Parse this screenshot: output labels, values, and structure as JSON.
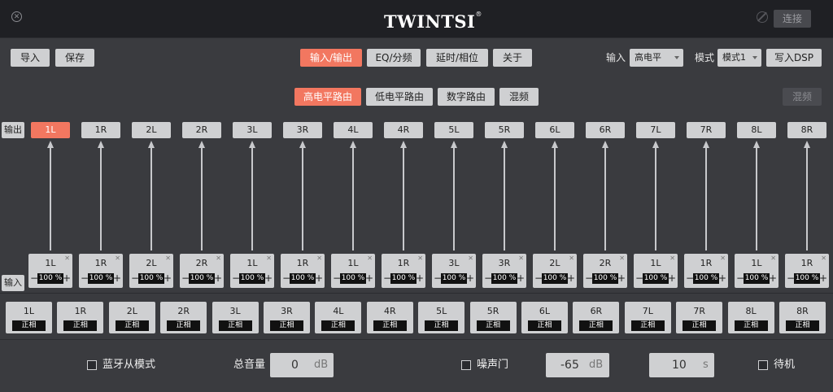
{
  "titlebar": {
    "logo": "TWINTSI",
    "registered": "®",
    "close_glyph": "✕",
    "connect_label": "连接"
  },
  "toolbar": {
    "import_label": "导入",
    "save_label": "保存",
    "tabs": [
      "输入/输出",
      "EQ/分频",
      "延时/相位",
      "关于"
    ],
    "active_tab": 0,
    "input_label": "输入",
    "input_value": "高电平",
    "mode_label": "模式",
    "mode_value": "模式1",
    "write_dsp_label": "写入DSP"
  },
  "routing": {
    "tabs": [
      "高电平路由",
      "低电平路由",
      "数字路由",
      "混频"
    ],
    "active_tab": 0,
    "mix_button_label": "混频"
  },
  "matrix": {
    "output_label": "输出",
    "input_label": "输入",
    "outputs": [
      "1L",
      "1R",
      "2L",
      "2R",
      "3L",
      "3R",
      "4L",
      "4R",
      "5L",
      "5R",
      "6L",
      "6R",
      "7L",
      "7R",
      "8L",
      "8R"
    ],
    "active_output": 0,
    "mix_inputs": [
      {
        "ch": "1L",
        "value": "100 %"
      },
      {
        "ch": "1R",
        "value": "100 %"
      },
      {
        "ch": "2L",
        "value": "100 %"
      },
      {
        "ch": "2R",
        "value": "100 %"
      },
      {
        "ch": "1L",
        "value": "100 %"
      },
      {
        "ch": "1R",
        "value": "100 %"
      },
      {
        "ch": "1L",
        "value": "100 %"
      },
      {
        "ch": "1R",
        "value": "100 %"
      },
      {
        "ch": "3L",
        "value": "100 %"
      },
      {
        "ch": "3R",
        "value": "100 %"
      },
      {
        "ch": "2L",
        "value": "100 %"
      },
      {
        "ch": "2R",
        "value": "100 %"
      },
      {
        "ch": "1L",
        "value": "100 %"
      },
      {
        "ch": "1R",
        "value": "100 %"
      },
      {
        "ch": "1L",
        "value": "100 %"
      },
      {
        "ch": "1R",
        "value": "100 %"
      }
    ],
    "minus": "−",
    "plus": "+",
    "remove": "✕"
  },
  "phase": {
    "channels": [
      "1L",
      "1R",
      "2L",
      "2R",
      "3L",
      "3R",
      "4L",
      "4R",
      "5L",
      "5R",
      "6L",
      "6R",
      "7L",
      "7R",
      "8L",
      "8R"
    ],
    "value": "正相"
  },
  "bottom": {
    "bt_slave_label": "蓝牙从模式",
    "master_volume_label": "总音量",
    "master_volume_value": "0",
    "master_volume_unit": "dB",
    "noise_gate_label": "噪声门",
    "noise_gate_value": "-65",
    "noise_gate_unit": "dB",
    "time_value": "10",
    "time_unit": "s",
    "standby_label": "待机"
  },
  "colors": {
    "accent": "#f27760",
    "background": "#3a3b3f",
    "titlebar": "#1f2024",
    "button": "#cfd0d2"
  }
}
